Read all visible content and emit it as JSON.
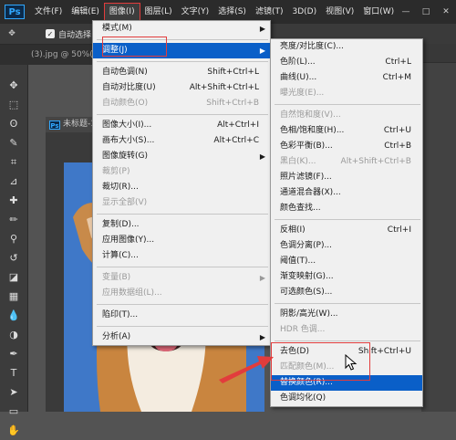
{
  "app": {
    "logo": "Ps"
  },
  "menubar": {
    "items": [
      "文件(F)",
      "编辑(E)",
      "图像(I)",
      "图层(L)",
      "文字(Y)",
      "选择(S)",
      "滤镜(T)",
      "3D(D)",
      "视图(V)",
      "窗口(W)"
    ],
    "active_index": 2
  },
  "window_controls": [
    "—",
    "□",
    "✕"
  ],
  "options_bar": {
    "auto_select_label": "自动选择:"
  },
  "doc_tab": {
    "label": "(3).jpg @ 50%(RGB/"
  },
  "doc_window": {
    "title": "未标题-1 @"
  },
  "image_menu": {
    "items": [
      {
        "label": "模式(M)",
        "shortcut": "",
        "submenu": true,
        "disabled": false
      },
      {
        "sep": true
      },
      {
        "label": "调整(J)",
        "shortcut": "",
        "submenu": true,
        "disabled": false,
        "highlight": true
      },
      {
        "sep": true
      },
      {
        "label": "自动色调(N)",
        "shortcut": "Shift+Ctrl+L",
        "disabled": false
      },
      {
        "label": "自动对比度(U)",
        "shortcut": "Alt+Shift+Ctrl+L",
        "disabled": false
      },
      {
        "label": "自动颜色(O)",
        "shortcut": "Shift+Ctrl+B",
        "disabled": true
      },
      {
        "sep": true
      },
      {
        "label": "图像大小(I)...",
        "shortcut": "Alt+Ctrl+I",
        "disabled": false
      },
      {
        "label": "画布大小(S)...",
        "shortcut": "Alt+Ctrl+C",
        "disabled": false
      },
      {
        "label": "图像旋转(G)",
        "shortcut": "",
        "submenu": true,
        "disabled": false
      },
      {
        "label": "裁剪(P)",
        "shortcut": "",
        "disabled": true
      },
      {
        "label": "裁切(R)...",
        "shortcut": "",
        "disabled": false
      },
      {
        "label": "显示全部(V)",
        "shortcut": "",
        "disabled": true
      },
      {
        "sep": true
      },
      {
        "label": "复制(D)...",
        "shortcut": "",
        "disabled": false
      },
      {
        "label": "应用图像(Y)...",
        "shortcut": "",
        "disabled": false
      },
      {
        "label": "计算(C)...",
        "shortcut": "",
        "disabled": false
      },
      {
        "sep": true
      },
      {
        "label": "变量(B)",
        "shortcut": "",
        "submenu": true,
        "disabled": true
      },
      {
        "label": "应用数据组(L)...",
        "shortcut": "",
        "disabled": true
      },
      {
        "sep": true
      },
      {
        "label": "陷印(T)...",
        "shortcut": "",
        "disabled": false
      },
      {
        "sep": true
      },
      {
        "label": "分析(A)",
        "shortcut": "",
        "submenu": true,
        "disabled": false
      }
    ]
  },
  "adjust_menu": {
    "items": [
      {
        "label": "亮度/对比度(C)...",
        "shortcut": "",
        "disabled": false
      },
      {
        "label": "色阶(L)...",
        "shortcut": "Ctrl+L",
        "disabled": false
      },
      {
        "label": "曲线(U)...",
        "shortcut": "Ctrl+M",
        "disabled": false
      },
      {
        "label": "曝光度(E)...",
        "shortcut": "",
        "disabled": true
      },
      {
        "sep": true
      },
      {
        "label": "自然饱和度(V)...",
        "shortcut": "",
        "disabled": true
      },
      {
        "label": "色相/饱和度(H)...",
        "shortcut": "Ctrl+U",
        "disabled": false
      },
      {
        "label": "色彩平衡(B)...",
        "shortcut": "Ctrl+B",
        "disabled": false
      },
      {
        "label": "黑白(K)...",
        "shortcut": "Alt+Shift+Ctrl+B",
        "disabled": true
      },
      {
        "label": "照片滤镜(F)...",
        "shortcut": "",
        "disabled": false
      },
      {
        "label": "通道混合器(X)...",
        "shortcut": "",
        "disabled": false
      },
      {
        "label": "颜色查找...",
        "shortcut": "",
        "disabled": false
      },
      {
        "sep": true
      },
      {
        "label": "反相(I)",
        "shortcut": "Ctrl+I",
        "disabled": false
      },
      {
        "label": "色调分离(P)...",
        "shortcut": "",
        "disabled": false
      },
      {
        "label": "阈值(T)...",
        "shortcut": "",
        "disabled": false
      },
      {
        "label": "渐变映射(G)...",
        "shortcut": "",
        "disabled": false
      },
      {
        "label": "可选颜色(S)...",
        "shortcut": "",
        "disabled": false
      },
      {
        "sep": true
      },
      {
        "label": "阴影/高光(W)...",
        "shortcut": "",
        "disabled": false
      },
      {
        "label": "HDR 色调...",
        "shortcut": "",
        "disabled": true
      },
      {
        "sep": true
      },
      {
        "label": "去色(D)",
        "shortcut": "Shift+Ctrl+U",
        "disabled": false
      },
      {
        "label": "匹配颜色(M)...",
        "shortcut": "",
        "disabled": true
      },
      {
        "label": "替换颜色(R)...",
        "shortcut": "",
        "disabled": false,
        "highlight": true
      },
      {
        "label": "色调均化(Q)",
        "shortcut": "",
        "disabled": false
      }
    ]
  },
  "toolbar": {
    "tools": [
      "move-icon",
      "marquee-icon",
      "lasso-icon",
      "quick-select-icon",
      "crop-icon",
      "eyedropper-icon",
      "healing-icon",
      "brush-icon",
      "stamp-icon",
      "history-brush-icon",
      "eraser-icon",
      "gradient-icon",
      "blur-icon",
      "dodge-icon",
      "pen-icon",
      "type-icon",
      "path-select-icon",
      "shape-icon",
      "hand-icon"
    ],
    "glyphs": [
      "✥",
      "⬚",
      "ʘ",
      "✎",
      "⌗",
      "⊿",
      "✚",
      "✏",
      "⚲",
      "↺",
      "◪",
      "▦",
      "💧",
      "◑",
      "✒",
      "T",
      "➤",
      "▭",
      "✋"
    ]
  },
  "colors": {
    "menubar_bg": "#2b2b2b",
    "menu_bg": "#f0f0f0",
    "highlight": "#0a5fc8",
    "annotation_red": "#e23c3c",
    "canvas_bg": "#3f78c8"
  }
}
